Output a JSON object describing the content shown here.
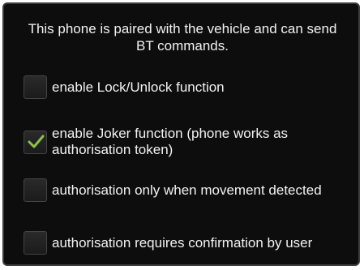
{
  "dialog": {
    "info_text": "This phone is paired with the vehicle and can send BT commands.",
    "options": [
      {
        "label": "enable Lock/Unlock function",
        "checked": false
      },
      {
        "label": "enable Joker function (phone works as authorisation token)",
        "checked": true
      },
      {
        "label": "authorisation only when movement detected",
        "checked": false
      },
      {
        "label": "authorisation requires confirmation by user",
        "checked": false
      }
    ]
  },
  "colors": {
    "background": "#0d0d0d",
    "checkmark": "#8bc34a",
    "text": "#f2f2f2"
  }
}
